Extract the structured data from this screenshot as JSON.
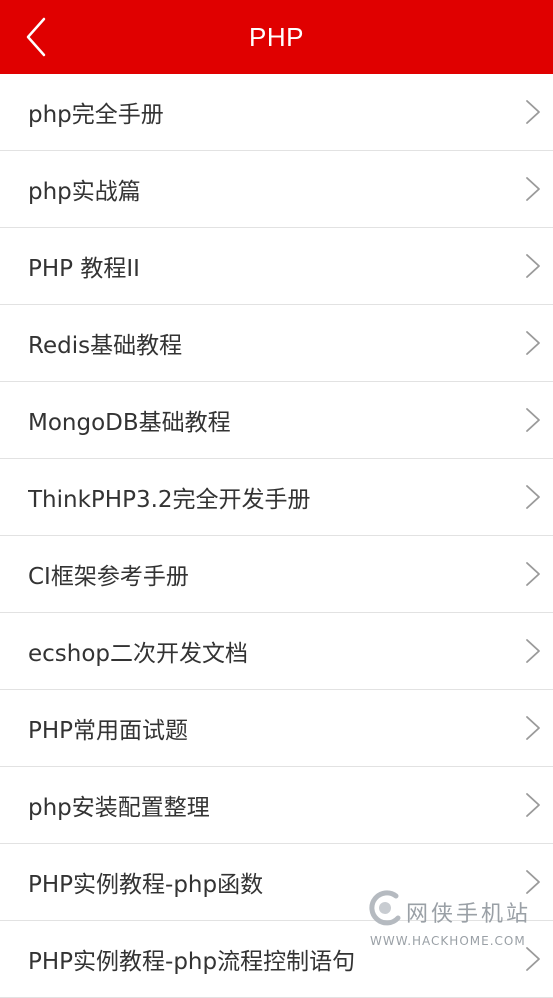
{
  "header": {
    "title": "PHP",
    "back_icon": "chevron-left-icon",
    "background_color": "#e00000"
  },
  "list": {
    "items": [
      {
        "label": "php完全手册"
      },
      {
        "label": "php实战篇"
      },
      {
        "label": "PHP 教程II"
      },
      {
        "label": "Redis基础教程"
      },
      {
        "label": "MongoDB基础教程"
      },
      {
        "label": "ThinkPHP3.2完全开发手册"
      },
      {
        "label": "CI框架参考手册"
      },
      {
        "label": "ecshop二次开发文档"
      },
      {
        "label": "PHP常用面试题"
      },
      {
        "label": "php安装配置整理"
      },
      {
        "label": "PHP实例教程-php函数"
      },
      {
        "label": "PHP实例教程-php流程控制语句"
      }
    ],
    "item_icon": "chevron-right-icon"
  },
  "watermark": {
    "title": "网侠手机站",
    "url": "WWW.HACKHOME.COM"
  }
}
